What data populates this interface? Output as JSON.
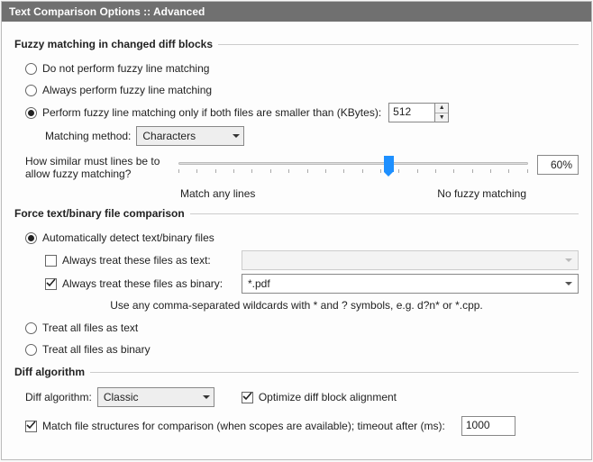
{
  "window": {
    "title": "Text Comparison Options :: Advanced"
  },
  "fuzzy": {
    "legend": "Fuzzy matching in changed diff blocks",
    "opt_none": "Do not perform fuzzy line matching",
    "opt_always": "Always perform fuzzy line matching",
    "opt_small": "Perform fuzzy line matching only if both files are smaller than (KBytes):",
    "size_value": "512",
    "method_label": "Matching method:",
    "method_value": "Characters",
    "similar_label": "How similar must lines be to allow fuzzy matching?",
    "similar_value": "60%",
    "end_left": "Match any lines",
    "end_right": "No fuzzy matching"
  },
  "force": {
    "legend": "Force text/binary file comparison",
    "opt_auto": "Automatically detect text/binary files",
    "chk_text": "Always treat these files as text:",
    "val_text": "",
    "chk_binary": "Always treat these files as binary:",
    "val_binary": "*.pdf",
    "hint": "Use any comma-separated wildcards with * and ? symbols, e.g. d?n* or *.cpp.",
    "opt_all_text": "Treat all files as text",
    "opt_all_binary": "Treat all files as binary"
  },
  "diff": {
    "legend": "Diff algorithm",
    "algo_label": "Diff algorithm:",
    "algo_value": "Classic",
    "optimize": "Optimize diff block alignment",
    "match_struct": "Match file structures for comparison (when scopes are available); timeout after (ms):",
    "timeout": "1000"
  }
}
